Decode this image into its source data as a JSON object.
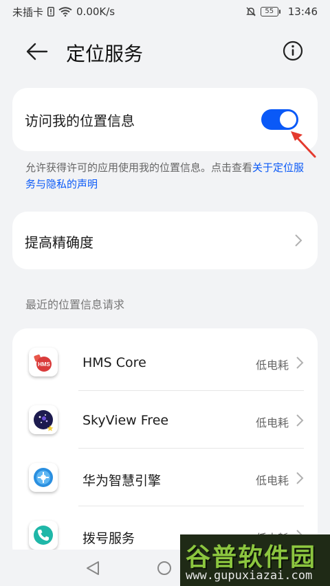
{
  "status_bar": {
    "sim": "未插卡",
    "speed": "0.00K/s",
    "battery": "55",
    "time": "13:46"
  },
  "header": {
    "title": "定位服务"
  },
  "location_access": {
    "label": "访问我的位置信息",
    "enabled": true,
    "accent_color": "#0a59f7"
  },
  "description": {
    "text": "允许获得许可的应用使用我的位置信息。点击查看",
    "link": "关于定位服务与隐私的声明"
  },
  "accuracy": {
    "label": "提高精确度"
  },
  "recent": {
    "section_title": "最近的位置信息请求",
    "apps": [
      {
        "name": "HMS Core",
        "power": "低电耗",
        "icon": "hms-core-icon"
      },
      {
        "name": "SkyView Free",
        "power": "低电耗",
        "icon": "skyview-icon"
      },
      {
        "name": "华为智慧引擎",
        "power": "低电耗",
        "icon": "huawei-engine-icon"
      },
      {
        "name": "拨号服务",
        "power": "低电耗",
        "icon": "dialer-icon"
      }
    ]
  },
  "watermark": {
    "main": "谷普软件园",
    "url": "www.gupuxiazai.com"
  }
}
